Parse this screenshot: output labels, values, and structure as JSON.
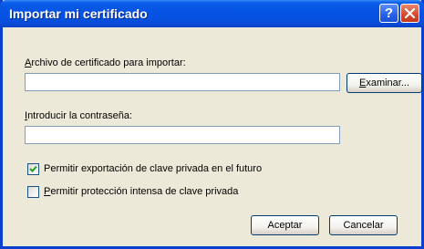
{
  "window": {
    "title": "Importar mi certificado",
    "help_button": "?",
    "close_button": "close"
  },
  "file_field": {
    "label_first": "A",
    "label_rest": "rchivo de certificado para importar:",
    "value": ""
  },
  "browse_button": {
    "label_first": "E",
    "label_rest": "xaminar..."
  },
  "password_field": {
    "label_first": "I",
    "label_rest": "ntroducir la contraseña:",
    "value": ""
  },
  "checkboxes": [
    {
      "label": "Permitir exportación de clave privada en el futuro",
      "checked": true
    },
    {
      "label_first": "P",
      "label_rest": "ermitir protección intensa de clave privada",
      "checked": false
    }
  ],
  "buttons": {
    "ok": "Aceptar",
    "cancel": "Cancelar"
  },
  "colors": {
    "titlebar": "#0653e4",
    "dialog_bg": "#ece9d8",
    "checkmark": "#21a121"
  }
}
